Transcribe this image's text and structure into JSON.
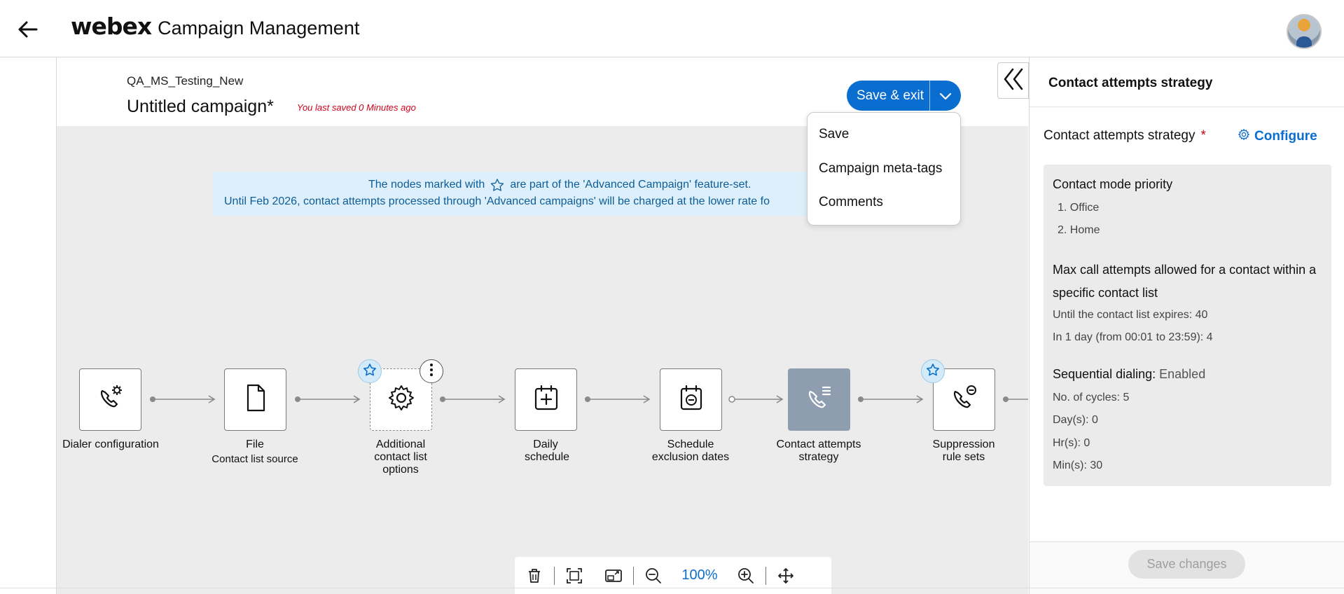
{
  "header": {
    "brand": "webex",
    "title": "Campaign Management"
  },
  "campaign": {
    "subtitle": "QA_MS_Testing_New",
    "name": "Untitled campaign*",
    "saved_status": "You last saved 0 Minutes ago",
    "save_exit_label": "Save & exit"
  },
  "save_menu": {
    "items": [
      "Save",
      "Campaign meta-tags",
      "Comments"
    ]
  },
  "banner": {
    "line1_pre": "The nodes marked with",
    "line1_post": "are part of the 'Advanced Campaign' feature-set.",
    "line2": "Until Feb 2026, contact attempts processed through 'Advanced campaigns' will be charged at the lower rate fo"
  },
  "nodes": [
    {
      "name": "dialer-configuration",
      "label": "Dialer configuration",
      "sub": "",
      "icon": "phone-gear-icon"
    },
    {
      "name": "file",
      "label": "File",
      "sub": "Contact list source",
      "icon": "file-icon"
    },
    {
      "name": "additional-contact-list-options",
      "label": "Additional contact list options",
      "sub": "",
      "icon": "gear-icon",
      "advanced": true
    },
    {
      "name": "daily-schedule",
      "label": "Daily schedule",
      "sub": "",
      "icon": "calendar-plus-icon"
    },
    {
      "name": "schedule-exclusion-dates",
      "label": "Schedule exclusion dates",
      "sub": "",
      "icon": "calendar-minus-icon"
    },
    {
      "name": "contact-attempts-strategy",
      "label": "Contact attempts strategy",
      "sub": "",
      "icon": "phone-list-icon",
      "active": true
    },
    {
      "name": "suppression-rule-sets",
      "label": "Suppression rule sets",
      "sub": "",
      "icon": "phone-block-icon",
      "advanced": true
    }
  ],
  "toolbar": {
    "zoom": "100%",
    "tools": [
      "delete-icon",
      "fit-to-screen-icon",
      "minimap-icon",
      "zoom-out-icon",
      "zoom-in-icon",
      "pan-icon"
    ]
  },
  "panel": {
    "title": "Contact attempts strategy",
    "field_label": "Contact attempts strategy",
    "required_mark": "*",
    "configure_label": "Configure",
    "summary": {
      "priority_heading": "Contact mode priority",
      "priority_items": [
        "1. Office",
        "2. Home"
      ],
      "max_heading": "Max call attempts allowed for a contact within a specific contact list",
      "max_items": [
        "Until the contact list expires: 40",
        "In 1 day (from 00:01 to 23:59): 4"
      ],
      "seq_heading": "Sequential dialing:",
      "seq_value": "Enabled",
      "seq_items": [
        "No. of cycles: 5",
        "Day(s): 0",
        "Hr(s): 0",
        "Min(s): 30"
      ]
    },
    "save_changes_label": "Save changes"
  }
}
